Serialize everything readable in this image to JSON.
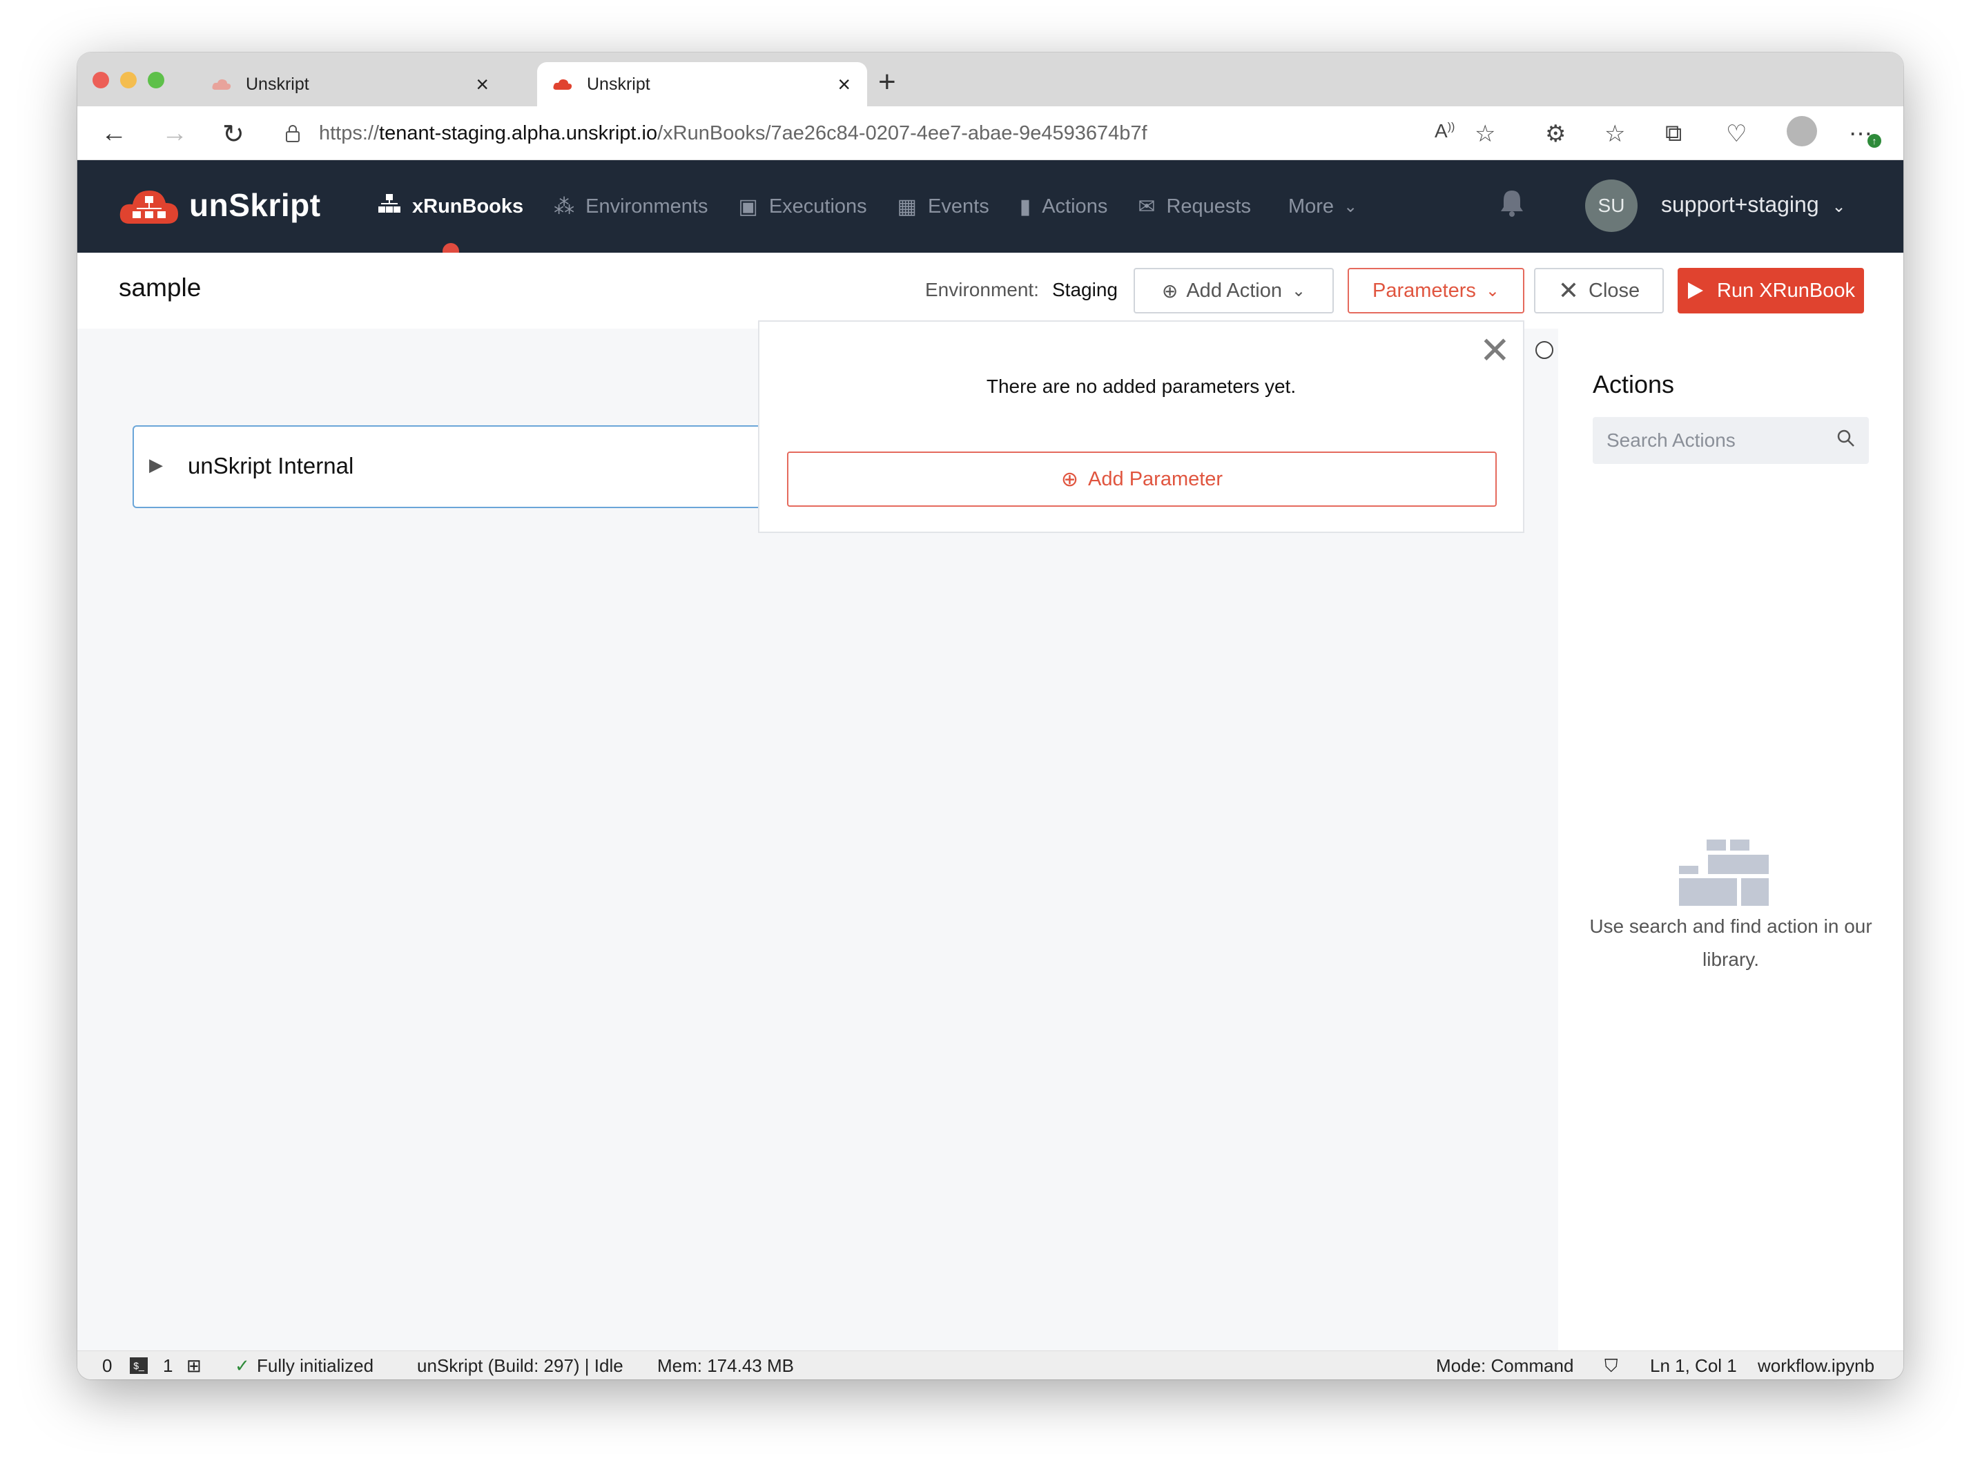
{
  "browser": {
    "tabs": [
      {
        "title": "Unskript",
        "active": false
      },
      {
        "title": "Unskript",
        "active": true
      }
    ],
    "url": {
      "scheme": "https://",
      "host": "tenant-staging.alpha.unskript.io",
      "path": "/xRunBooks/7ae26c84-0207-4ee7-abae-9e4593674b7f"
    }
  },
  "app": {
    "brand": "unSkript",
    "brand_color": "#e0432f",
    "header_bg": "#1f2937",
    "nav": [
      {
        "label": "xRunBooks",
        "icon": "sitemap-icon",
        "active": true
      },
      {
        "label": "Environments",
        "icon": "network-icon",
        "active": false
      },
      {
        "label": "Executions",
        "icon": "monitor-icon",
        "active": false
      },
      {
        "label": "Events",
        "icon": "calendar-icon",
        "active": false
      },
      {
        "label": "Actions",
        "icon": "book-icon",
        "active": false
      },
      {
        "label": "Requests",
        "icon": "inbox-icon",
        "active": false
      },
      {
        "label": "More",
        "icon": "chevron-down-icon",
        "active": false
      }
    ],
    "user": {
      "initials": "SU",
      "name": "support+staging"
    }
  },
  "toolbar": {
    "title": "sample",
    "environment_label": "Environment:",
    "environment_value": "Staging",
    "add_action": "Add Action",
    "parameters": "Parameters",
    "close": "Close",
    "run": "Run XRunBook"
  },
  "workspace": {
    "group_label": "unSkript Internal"
  },
  "parameters_popover": {
    "message": "There are no added parameters yet.",
    "add_button": "Add Parameter"
  },
  "sidebar": {
    "title": "Actions",
    "search_placeholder": "Search Actions",
    "empty_text": "Use search and find action in our library."
  },
  "statusbar": {
    "count_a": "0",
    "count_b": "1",
    "kernel_status": "Fully initialized",
    "build": "unSkript (Build: 297) | Idle",
    "mem": "Mem: 174.43 MB",
    "mode": "Mode: Command",
    "position": "Ln 1, Col 1",
    "file": "workflow.ipynb"
  }
}
